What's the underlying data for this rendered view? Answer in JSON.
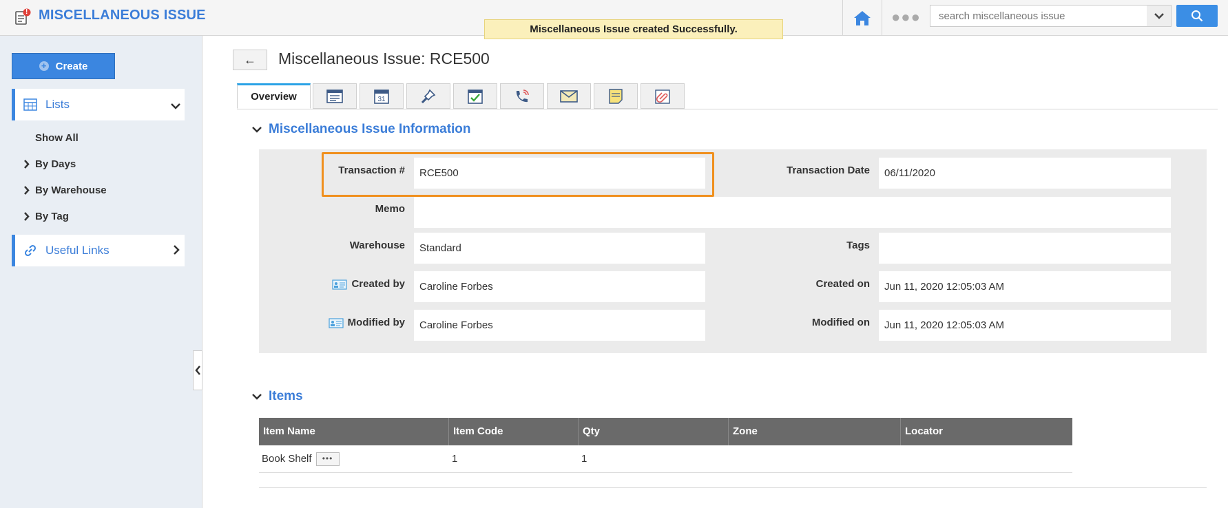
{
  "header": {
    "app_title": "MISCELLANEOUS ISSUE",
    "notification_badge": "!",
    "toast": "Miscellaneous Issue created Successfully.",
    "more_label": "●●●",
    "search_placeholder": "search miscellaneous issue"
  },
  "sidebar": {
    "create_label": "Create",
    "lists_label": "Lists",
    "show_all": "Show All",
    "sub_items": [
      "By Days",
      "By Warehouse",
      "By Tag"
    ],
    "useful_links": "Useful Links"
  },
  "page": {
    "back_label": "←",
    "title": "Miscellaneous Issue: RCE500",
    "tabs": {
      "overview": "Overview",
      "icons": [
        "details-icon",
        "calendar-icon",
        "pin-icon",
        "task-icon",
        "call-icon",
        "email-icon",
        "note-icon",
        "attachment-icon"
      ],
      "calendar_day": "31"
    }
  },
  "info": {
    "section_title": "Miscellaneous Issue Information",
    "transaction_label": "Transaction #",
    "transaction_value": "RCE500",
    "transaction_date_label": "Transaction Date",
    "transaction_date_value": "06/11/2020",
    "memo_label": "Memo",
    "memo_value": "",
    "warehouse_label": "Warehouse",
    "warehouse_value": "Standard",
    "tags_label": "Tags",
    "tags_value": "",
    "created_by_label": "Created by",
    "created_by_value": "Caroline Forbes",
    "created_on_label": "Created on",
    "created_on_value": "Jun 11, 2020 12:05:03 AM",
    "modified_by_label": "Modified by",
    "modified_by_value": "Caroline Forbes",
    "modified_on_label": "Modified on",
    "modified_on_value": "Jun 11, 2020 12:05:03 AM"
  },
  "items": {
    "section_title": "Items",
    "columns": [
      "Item Name",
      "Item Code",
      "Qty",
      "Zone",
      "Locator"
    ],
    "rows": [
      {
        "item_name": "Book Shelf",
        "item_code": "1",
        "qty": "1",
        "zone": "",
        "locator": ""
      }
    ],
    "row_action_label": "•••"
  },
  "colors": {
    "accent": "#3b7dd8",
    "highlight": "#f0901e",
    "toast_bg": "#fbf0bb",
    "table_header": "#6a6a6a"
  }
}
